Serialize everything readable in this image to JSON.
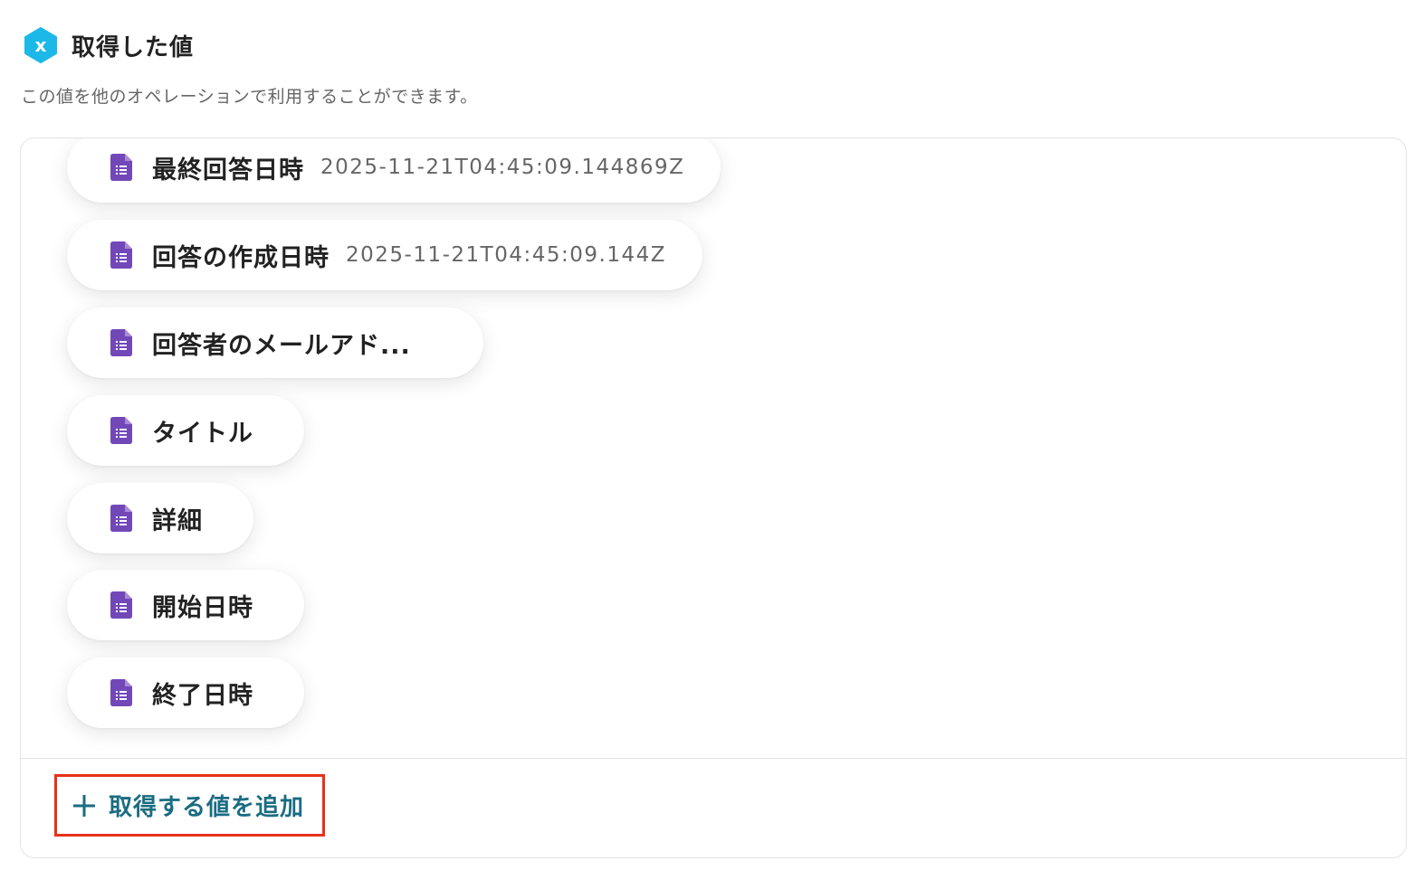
{
  "header": {
    "title": "取得した値",
    "icon": "hexagon-x-icon",
    "icon_color": "#1cb8e8"
  },
  "subtitle": "この値を他のオペレーションで利用することができます。",
  "items": [
    {
      "label": "最終回答日時",
      "value": "2025-11-21T04:45:09.144869Z",
      "icon": "google-forms-doc-icon"
    },
    {
      "label": "回答の作成日時",
      "value": "2025-11-21T04:45:09.144Z",
      "icon": "google-forms-doc-icon"
    },
    {
      "label": "回答者のメールアド...",
      "value": "",
      "icon": "google-forms-doc-icon"
    },
    {
      "label": "タイトル",
      "value": "",
      "icon": "google-forms-doc-icon"
    },
    {
      "label": "詳細",
      "value": "",
      "icon": "google-forms-doc-icon"
    },
    {
      "label": "開始日時",
      "value": "",
      "icon": "google-forms-doc-icon"
    },
    {
      "label": "終了日時",
      "value": "",
      "icon": "google-forms-doc-icon"
    }
  ],
  "add_button": {
    "label": "取得する値を追加",
    "icon": "plus-icon",
    "text_color": "#1a6c82",
    "highlight_color": "#e8311b"
  },
  "colors": {
    "forms_purple": "#7248b9"
  }
}
